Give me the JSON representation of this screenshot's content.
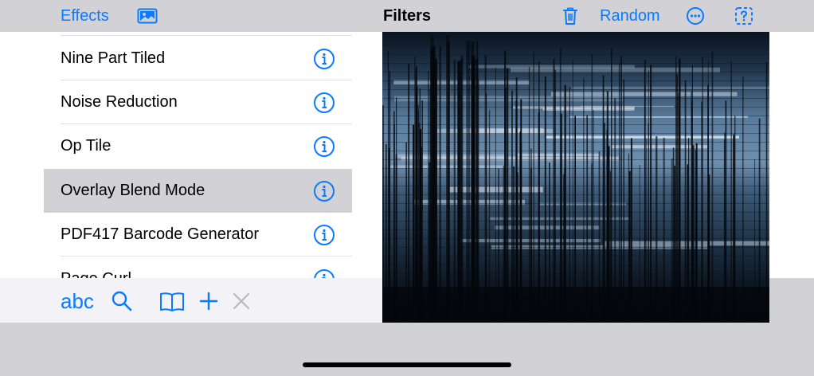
{
  "nav": {
    "effects_label": "Effects",
    "photo_icon": "photo-icon",
    "title": "Filters",
    "trash_icon": "trash-icon",
    "random_label": "Random",
    "more_icon": "ellipsis-circle-icon",
    "help_icon": "questionmark-square-dashed-icon"
  },
  "filters": {
    "items": [
      {
        "label": "Nine Part Tiled",
        "selected": false
      },
      {
        "label": "Noise Reduction",
        "selected": false
      },
      {
        "label": "Op Tile",
        "selected": false
      },
      {
        "label": "Overlay Blend Mode",
        "selected": true
      },
      {
        "label": "PDF417 Barcode Generator",
        "selected": false
      },
      {
        "label": "Page Curl",
        "selected": false
      }
    ]
  },
  "toolbar": {
    "abc_label": "abc",
    "search_icon": "search-icon",
    "book_icon": "book-icon",
    "add_icon": "plus-icon",
    "clear_icon": "close-icon"
  },
  "colors": {
    "accent": "#0a7aff",
    "chrome": "#d1d1d6",
    "selected_row": "#d1d1d6",
    "toolbar_bg": "#f2f2f7"
  }
}
